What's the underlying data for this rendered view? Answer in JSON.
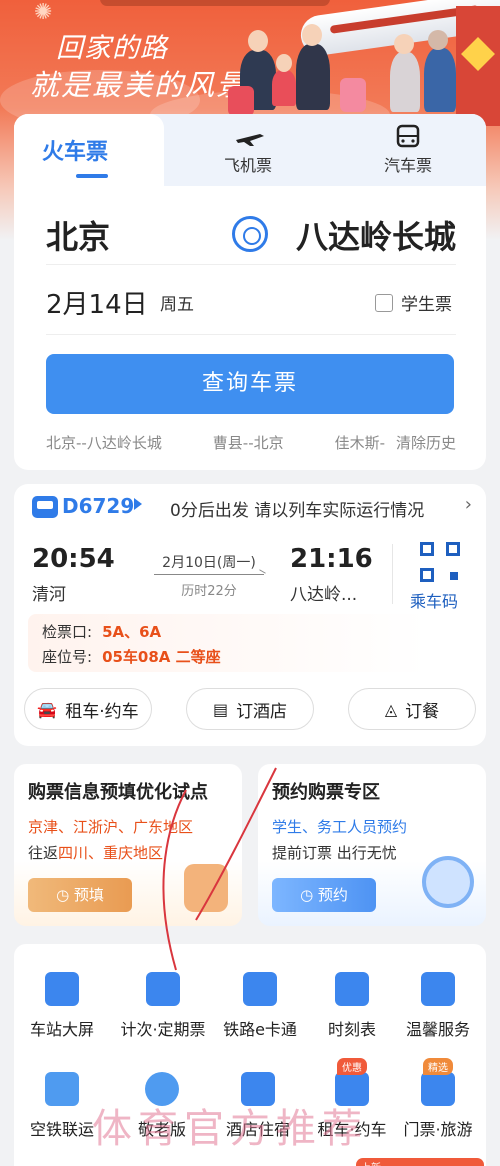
{
  "banner": {
    "slogan_line1": "回家的路",
    "slogan_line2": "就是最美的风景"
  },
  "tabs": {
    "train": "火车票",
    "flight": "飞机票",
    "bus": "汽车票"
  },
  "search": {
    "from": "北京",
    "to": "八达岭长城",
    "date": "2月14日",
    "weekday": "周五",
    "student": "学生票",
    "query": "查询车票",
    "history": [
      "北京--八达岭长城",
      "曹县--北京",
      "佳木斯-",
      "清除历史"
    ]
  },
  "trip": {
    "train_no": "D6729",
    "notice": "0分后出发 请以列车实际运行情况",
    "dep_time": "20:54",
    "dep_station": "清河",
    "date": "2月10日(周一)",
    "duration": "历时22分",
    "arr_time": "21:16",
    "arr_station": "八达岭...",
    "qr_label": "乘车码",
    "gate_label": "检票口:",
    "gate_value": "5A、6A",
    "seat_label": "座位号:",
    "seat_value": "05车08A 二等座",
    "actions": [
      "租车·约车",
      "订酒店",
      "订餐"
    ]
  },
  "promo": {
    "a": {
      "title": "购票信息预填优化试点",
      "line1": "京津、江浙沪、广东地区",
      "line2_prefix": "往返",
      "line2_hl": "四川、重庆地区",
      "button": "预填"
    },
    "b": {
      "title": "预约购票专区",
      "line1": "学生、务工人员预约",
      "line2": "提前订票 出行无忧",
      "button": "预约"
    }
  },
  "grid": {
    "row1": [
      "车站大屏",
      "计次·定期票",
      "铁路e卡通",
      "时刻表",
      "温馨服务"
    ],
    "row2": [
      "空铁联运",
      "敬老版",
      "酒店住宿",
      "租车·约车",
      "门票·旅游"
    ],
    "badges": {
      "car": "优惠",
      "ticket": "精选",
      "extra": "上新"
    }
  },
  "watermark": "体育官方推荐",
  "colors": {
    "accent": "#2f7be8",
    "orange": "#e8501a",
    "banner": "#f0603c"
  }
}
